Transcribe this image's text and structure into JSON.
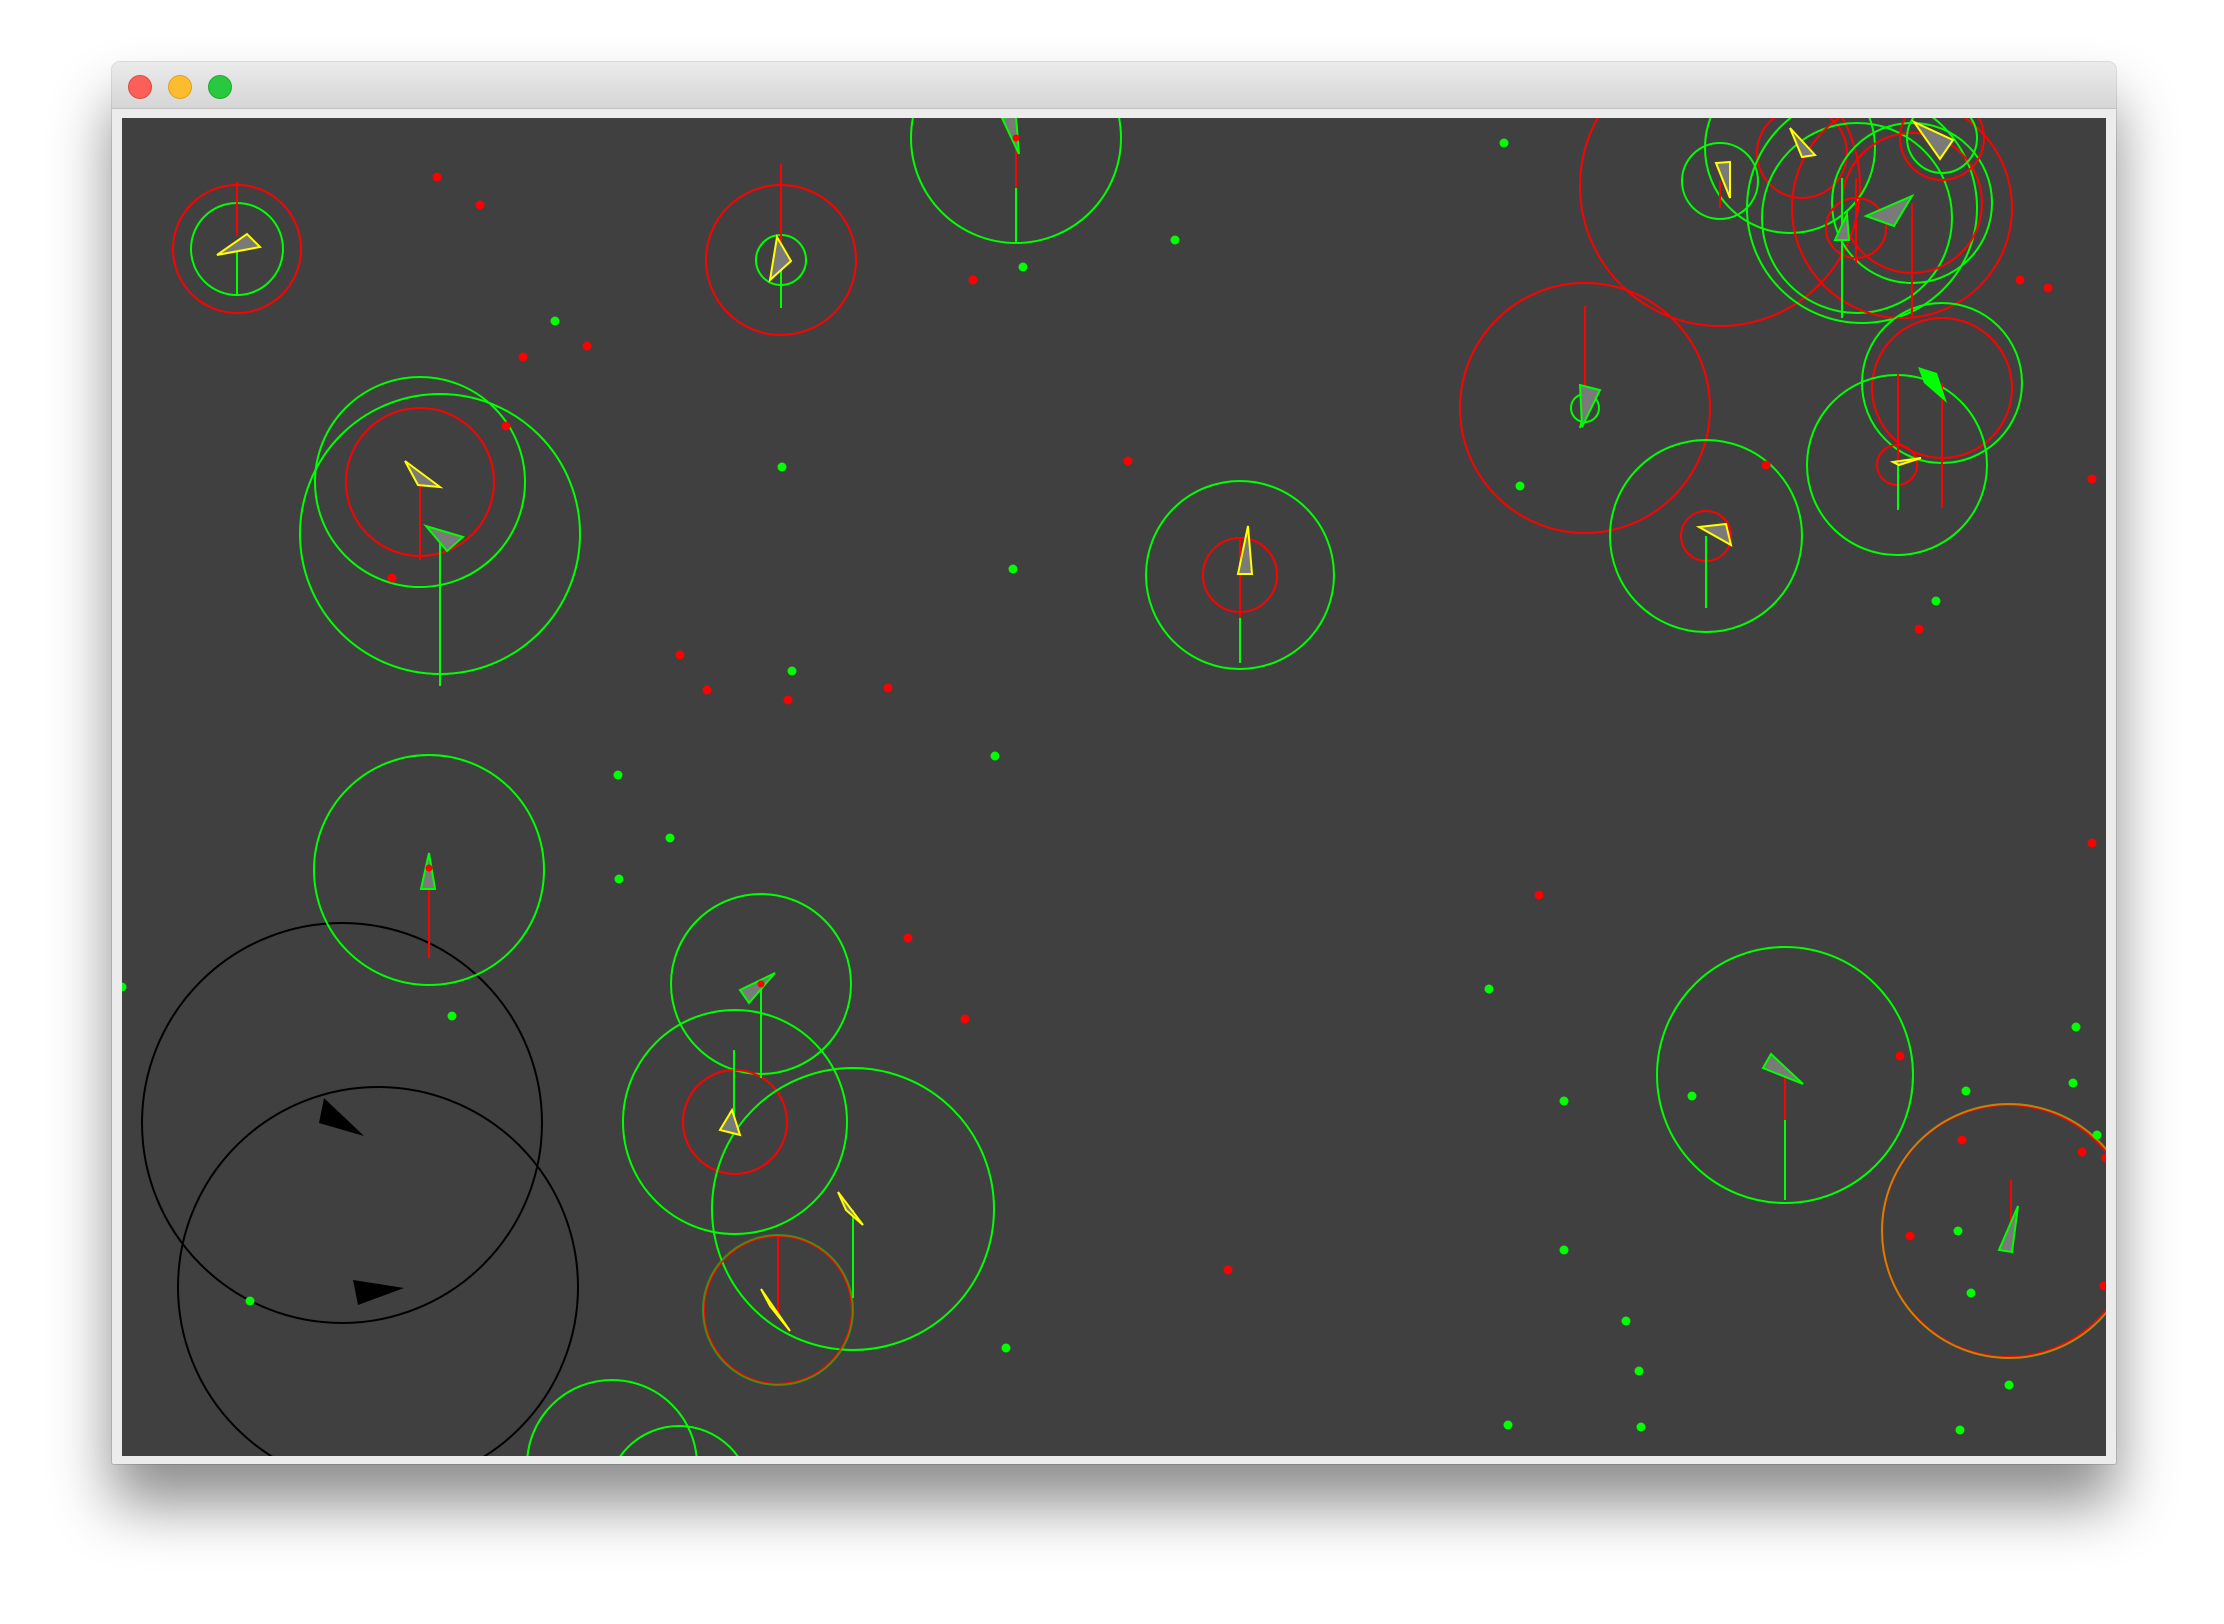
{
  "window": {
    "title": ""
  },
  "icons": {
    "close": "close-icon",
    "minimize": "minimize-icon",
    "zoom": "zoom-icon"
  },
  "colors": {
    "background": "#404040",
    "green": "#00ff00",
    "red": "#ff0000",
    "yellow": "#ffff00",
    "agent_fill": "#7a7a7a",
    "black": "#000000"
  }
}
